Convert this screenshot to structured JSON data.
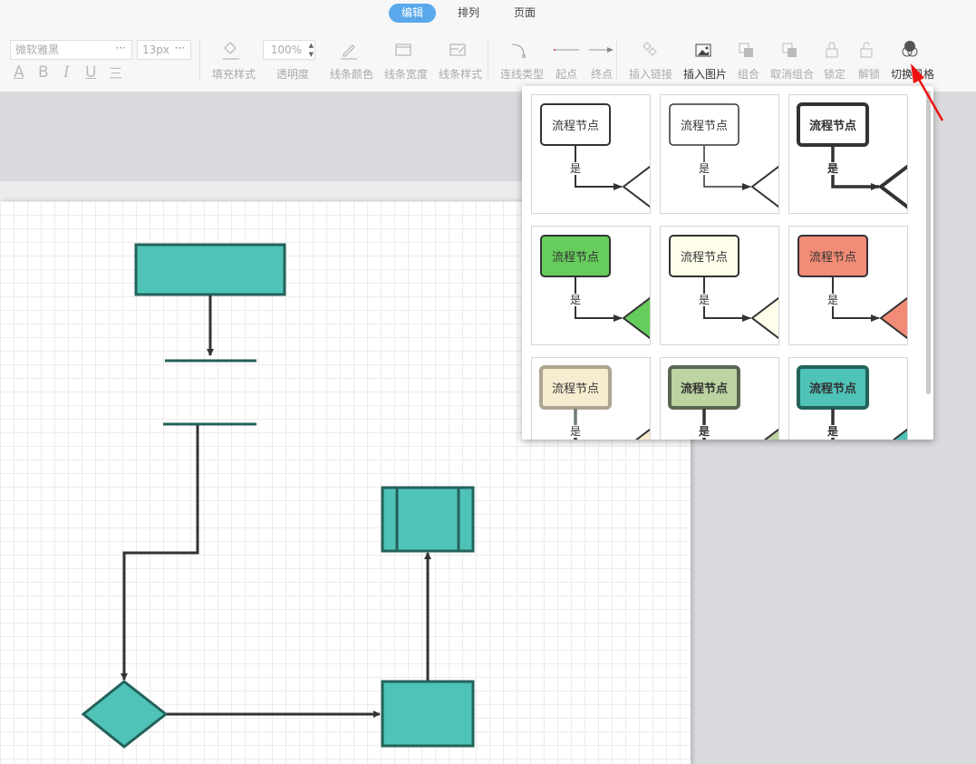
{
  "tabs": [
    {
      "label": "编辑",
      "active": true
    },
    {
      "label": "排列",
      "active": false
    },
    {
      "label": "页面",
      "active": false
    }
  ],
  "toolbar": {
    "font_family": "微软雅黑",
    "font_size": "13px",
    "opacity": "100%",
    "format": {
      "font_color": "A",
      "bold": "B",
      "italic": "I",
      "underline": "U",
      "strikethrough": "三"
    },
    "tools": [
      {
        "label": "填充样式",
        "icon": "fill-bucket-icon",
        "enabled": false
      },
      {
        "label": "透明度",
        "icon": "opacity-icon",
        "enabled": false
      },
      {
        "label": "线条颜色",
        "icon": "pencil-icon",
        "enabled": false
      },
      {
        "label": "线条宽度",
        "icon": "line-width-icon",
        "enabled": false
      },
      {
        "label": "线条样式",
        "icon": "line-style-icon",
        "enabled": false
      },
      {
        "label": "连线类型",
        "icon": "connector-type-icon",
        "enabled": false
      },
      {
        "label": "起点",
        "icon": "line-start-icon",
        "enabled": false
      },
      {
        "label": "终点",
        "icon": "arrow-end-icon",
        "enabled": false
      },
      {
        "label": "插入链接",
        "icon": "link-icon",
        "enabled": false
      },
      {
        "label": "插入图片",
        "icon": "image-icon",
        "enabled": true
      },
      {
        "label": "组合",
        "icon": "group-icon",
        "enabled": false
      },
      {
        "label": "取消组合",
        "icon": "ungroup-icon",
        "enabled": false
      },
      {
        "label": "锁定",
        "icon": "lock-icon",
        "enabled": false
      },
      {
        "label": "解锁",
        "icon": "unlock-icon",
        "enabled": false
      },
      {
        "label": "切换风格",
        "icon": "theme-switch-icon",
        "enabled": true
      }
    ]
  },
  "theme_popup": {
    "node_text": "流程节点",
    "edge_label": "是",
    "styles": [
      {
        "fill": "#ffffff",
        "stroke": "#333333",
        "width": 2,
        "bold": false
      },
      {
        "fill": "#ffffff",
        "stroke": "#333333",
        "width": 1.5,
        "bold": false
      },
      {
        "fill": "#ffffff",
        "stroke": "#333333",
        "width": 4,
        "bold": true
      },
      {
        "fill": "#66cc5c",
        "stroke": "#333333",
        "width": 2,
        "bold": false
      },
      {
        "fill": "#fdfdea",
        "stroke": "#333333",
        "width": 2,
        "bold": false
      },
      {
        "fill": "#f28c76",
        "stroke": "#333333",
        "width": 2,
        "bold": false
      },
      {
        "fill": "#f6ecd0",
        "stroke": "#ada58f",
        "width": 4,
        "bold": false,
        "line": "#6e7b7b"
      },
      {
        "fill": "#bdd3a1",
        "stroke": "#5a6650",
        "width": 4,
        "bold": true
      },
      {
        "fill": "#4fc3b8",
        "stroke": "#23625b",
        "width": 4,
        "bold": true
      }
    ]
  },
  "diagram": {
    "fill": "#4fc3b8",
    "stroke": "#23625b",
    "line": "#333333"
  },
  "annotation": {
    "color": "#ee1111"
  }
}
